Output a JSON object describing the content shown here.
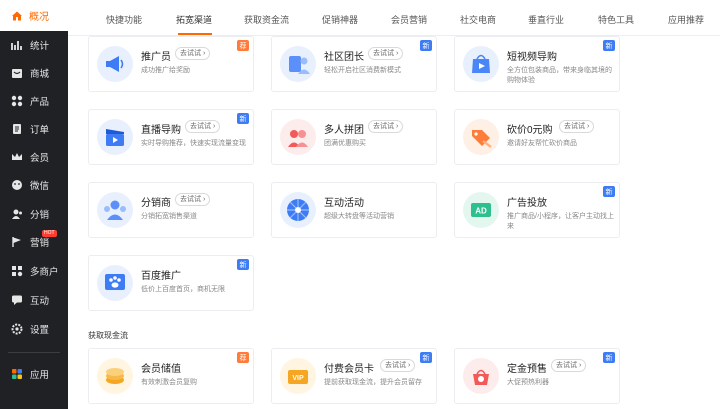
{
  "sidebar": {
    "active": {
      "label": "概况",
      "icon": "home-icon"
    },
    "items": [
      {
        "label": "统计",
        "icon": "stats-icon"
      },
      {
        "label": "商城",
        "icon": "store-icon"
      },
      {
        "label": "产品",
        "icon": "grid-icon"
      },
      {
        "label": "订单",
        "icon": "order-icon"
      },
      {
        "label": "会员",
        "icon": "crown-icon"
      },
      {
        "label": "微信",
        "icon": "wechat-icon"
      },
      {
        "label": "分销",
        "icon": "distribution-icon"
      },
      {
        "label": "营销",
        "icon": "flag-icon",
        "tag": "HOT"
      },
      {
        "label": "多商户",
        "icon": "merchant-icon"
      },
      {
        "label": "互动",
        "icon": "chat-icon"
      },
      {
        "label": "设置",
        "icon": "gear-icon"
      },
      {
        "label": "应用",
        "icon": "apps-icon"
      }
    ]
  },
  "tabs": [
    "快捷功能",
    "拓宽渠道",
    "获取资金流",
    "促销神器",
    "会员营销",
    "社交电商",
    "垂直行业",
    "特色工具",
    "应用推荐"
  ],
  "active_tab": "拓宽渠道",
  "try_label": "去试试",
  "badges": {
    "new": "新",
    "rec": "荐"
  },
  "cards": [
    {
      "title": "推广员",
      "try": true,
      "desc": "成功推广给奖励",
      "badge": "rec",
      "icon": "megaphone-icon",
      "color": "#3d7cf4"
    },
    {
      "title": "社区团长",
      "try": true,
      "desc": "轻松开启社区消费新模式",
      "badge": "new",
      "icon": "community-icon",
      "color": "#5b8ff9"
    },
    {
      "title": "短视频导购",
      "try": false,
      "desc": "全方位包装商品，带来身临其境的购物体验",
      "badge": "new",
      "icon": "video-bag-icon",
      "color": "#4a86f7"
    },
    {
      "title": "直播导购",
      "try": true,
      "desc": "实时导购推荐，快速实现流量变现",
      "badge": "new",
      "icon": "clapper-icon",
      "color": "#3d7cf4"
    },
    {
      "title": "多人拼团",
      "try": true,
      "desc": "团满优惠购买",
      "badge": "",
      "icon": "group-buy-icon",
      "color": "#f25a5a"
    },
    {
      "title": "砍价0元购",
      "try": true,
      "desc": "邀请好友帮忙砍价商品",
      "badge": "",
      "icon": "knife-tag-icon",
      "color": "#ff7b3a"
    },
    {
      "title": "分销商",
      "try": true,
      "desc": "分销拓宽销售渠道",
      "badge": "",
      "icon": "distributor-icon",
      "color": "#5b8ff9"
    },
    {
      "title": "互动活动",
      "try": false,
      "desc": "超级大转盘等活动营销",
      "badge": "",
      "icon": "wheel-icon",
      "color": "#3d7cf4"
    },
    {
      "title": "广告投放",
      "try": false,
      "desc": "推广商品/小程序，让客户主动找上来",
      "badge": "new",
      "icon": "ad-icon",
      "color": "#2fbf8f"
    },
    {
      "title": "百度推广",
      "try": false,
      "desc": "低价上百度首页，商机无限",
      "badge": "new",
      "icon": "baidu-icon",
      "color": "#3d7cf4"
    }
  ],
  "section2": {
    "title": "获取现金流",
    "cards": [
      {
        "title": "会员储值",
        "try": false,
        "desc": "有效刺激会员复购",
        "badge": "rec",
        "icon": "coin-icon",
        "color": "#f5a623"
      },
      {
        "title": "付费会员卡",
        "try": true,
        "desc": "提前获取现金流，提升会员留存",
        "badge": "new",
        "icon": "vip-card-icon",
        "color": "#f5a623"
      },
      {
        "title": "定金预售",
        "try": true,
        "desc": "大促预热利器",
        "badge": "new",
        "icon": "deposit-icon",
        "color": "#f25a5a"
      }
    ]
  }
}
